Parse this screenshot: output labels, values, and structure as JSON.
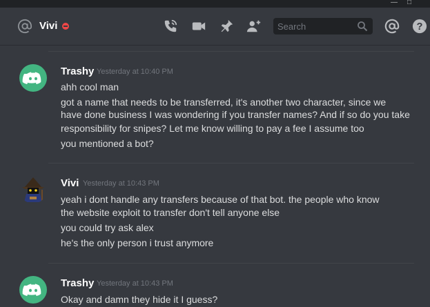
{
  "header": {
    "dm_name": "Vivi",
    "search_placeholder": "Search"
  },
  "icons": [
    "at-icon",
    "dnd-status-icon",
    "call-icon",
    "video-icon",
    "pin-icon",
    "add-friend-icon",
    "search-icon",
    "mentions-icon",
    "help-icon",
    "minimize-icon",
    "maximize-icon"
  ],
  "messages": [
    {
      "author": "Trashy",
      "timestamp": "Yesterday at 10:40 PM",
      "lines": [
        "ahh cool man",
        "got a name that needs to be transferred, it's another two character, since we",
        "have done business I was wondering if you transfer names? And if so do you take",
        "responsibility for snipes? Let me know willing to pay a fee I assume too",
        "you mentioned a bot?"
      ]
    },
    {
      "author": "Vivi",
      "timestamp": "Yesterday at 10:43 PM",
      "lines": [
        "yeah i dont handle any transfers because of that bot. the people who know",
        "the website exploit to transfer don't tell anyone else",
        "you could try ask alex",
        "he's the only person i trust anymore"
      ]
    },
    {
      "author": "Trashy",
      "timestamp": "Yesterday at 10:43 PM",
      "lines": [
        "Okay and damn they hide it I guess?"
      ]
    }
  ],
  "colors": {
    "background": "#36393f",
    "discord_blurple_green": "#43b581",
    "dnd_red": "#f04747"
  }
}
